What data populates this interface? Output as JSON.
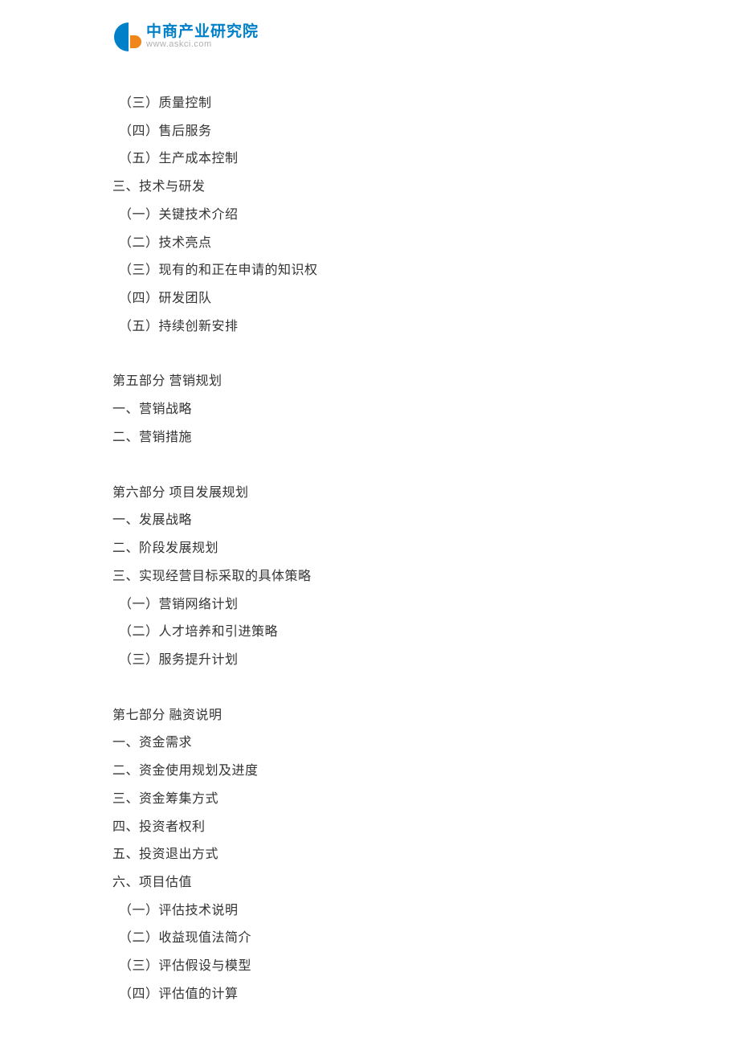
{
  "logo": {
    "cn": "中商产业研究院",
    "en": "www.askci.com"
  },
  "toc": {
    "items": [
      {
        "text": "（三）质量控制",
        "indent": 1
      },
      {
        "text": "（四）售后服务",
        "indent": 1
      },
      {
        "text": "（五）生产成本控制",
        "indent": 1
      },
      {
        "text": "三、技术与研发",
        "indent": 0
      },
      {
        "text": "（一）关键技术介绍",
        "indent": 1
      },
      {
        "text": "（二）技术亮点",
        "indent": 1
      },
      {
        "text": "（三）现有的和正在申请的知识权",
        "indent": 1
      },
      {
        "text": "（四）研发团队",
        "indent": 1
      },
      {
        "text": "（五）持续创新安排",
        "indent": 1
      },
      {
        "gap": true
      },
      {
        "text": "第五部分 营销规划",
        "indent": 0
      },
      {
        "text": "一、营销战略",
        "indent": 0
      },
      {
        "text": "二、营销措施",
        "indent": 0
      },
      {
        "gap": true
      },
      {
        "text": "第六部分 项目发展规划",
        "indent": 0
      },
      {
        "text": "一、发展战略",
        "indent": 0
      },
      {
        "text": "二、阶段发展规划",
        "indent": 0
      },
      {
        "text": "三、实现经营目标采取的具体策略",
        "indent": 0
      },
      {
        "text": "（一）营销网络计划",
        "indent": 1
      },
      {
        "text": "（二）人才培养和引进策略",
        "indent": 1
      },
      {
        "text": "（三）服务提升计划",
        "indent": 1
      },
      {
        "gap": true
      },
      {
        "text": "第七部分 融资说明",
        "indent": 0
      },
      {
        "text": "一、资金需求",
        "indent": 0
      },
      {
        "text": "二、资金使用规划及进度",
        "indent": 0
      },
      {
        "text": "三、资金筹集方式",
        "indent": 0
      },
      {
        "text": "四、投资者权利",
        "indent": 0
      },
      {
        "text": "五、投资退出方式",
        "indent": 0
      },
      {
        "text": "六、项目估值",
        "indent": 0
      },
      {
        "text": "（一）评估技术说明",
        "indent": 1
      },
      {
        "text": "（二）收益现值法简介",
        "indent": 1
      },
      {
        "text": "（三）评估假设与模型",
        "indent": 1
      },
      {
        "text": "（四）评估值的计算",
        "indent": 1
      }
    ]
  }
}
